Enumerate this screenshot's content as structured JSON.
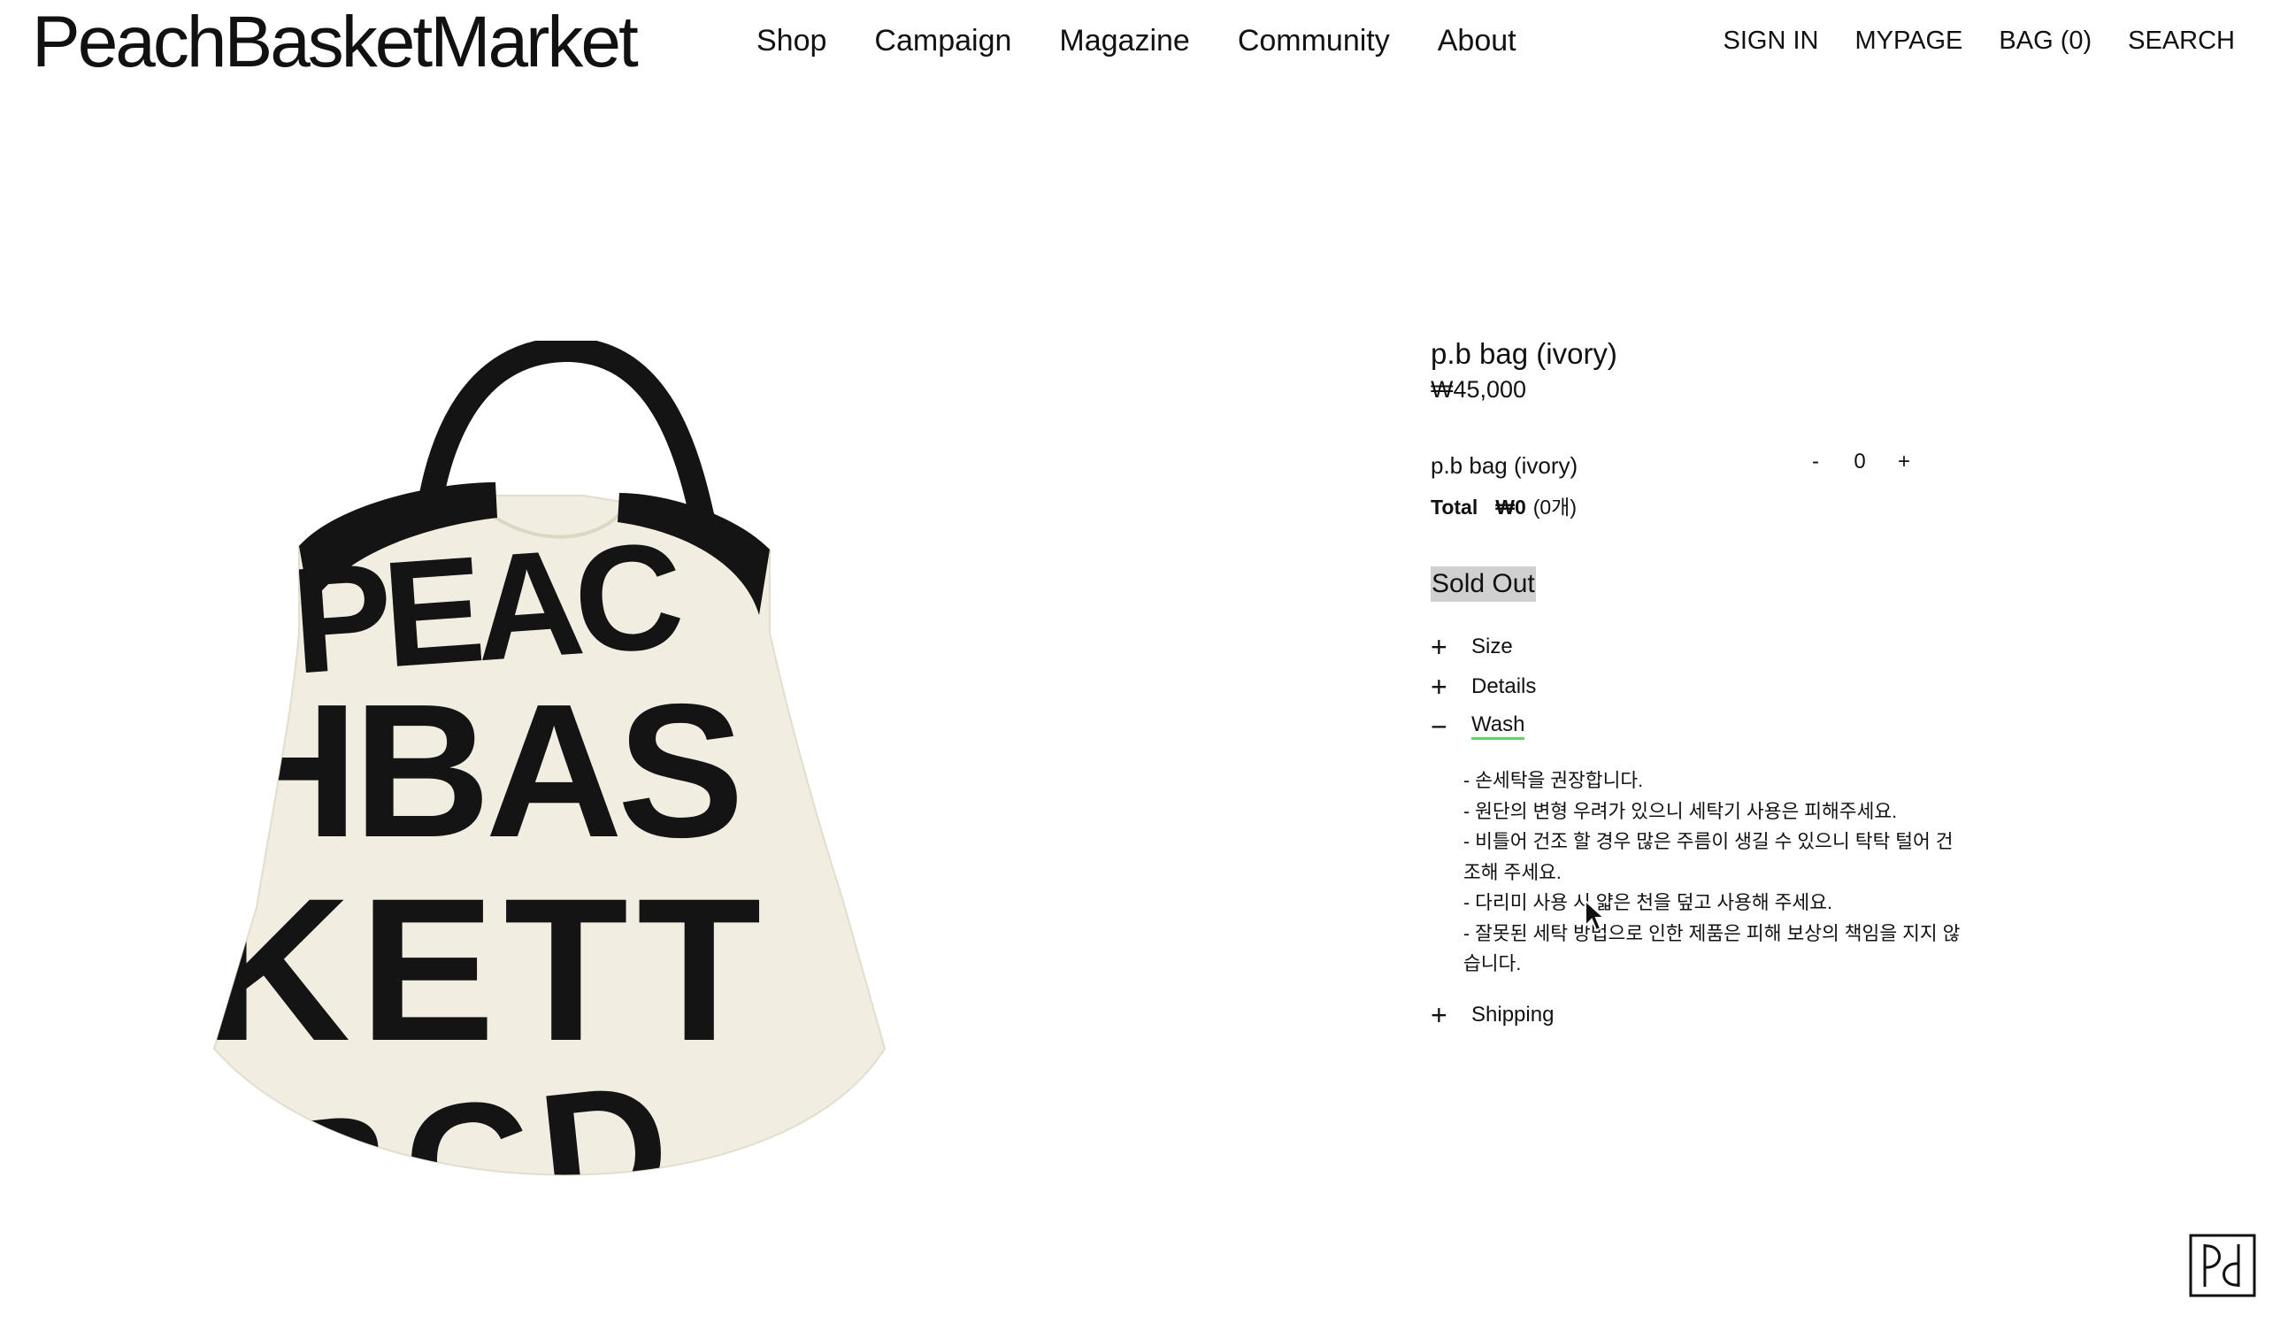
{
  "header": {
    "logo": "PeachBasketMarket",
    "nav": [
      "Shop",
      "Campaign",
      "Magazine",
      "Community",
      "About"
    ],
    "util": [
      "SIGN IN",
      "MYPAGE",
      "BAG (0)",
      "SEARCH"
    ]
  },
  "product": {
    "image_text_lines": [
      "PEAC",
      "HBAS",
      "KETT",
      "BCD"
    ],
    "title": "p.b bag (ivory)",
    "price": "₩45,000",
    "option": {
      "name": "p.b bag (ivory)",
      "minus": "-",
      "quantity": "0",
      "plus": "+"
    },
    "total": {
      "label": "Total",
      "amount": "₩0",
      "count": "(0개)"
    },
    "sold_out": "Sold Out",
    "accordion": {
      "size": {
        "symbol": "+",
        "label": "Size"
      },
      "details": {
        "symbol": "+",
        "label": "Details"
      },
      "wash": {
        "symbol": "−",
        "label": "Wash"
      },
      "shipping": {
        "symbol": "+",
        "label": "Shipping"
      }
    },
    "wash_lines": [
      "- 손세탁을 권장합니다.",
      "- 원단의 변형 우려가 있으니 세탁기 사용은 피해주세요.",
      "- 비틀어 건조 할 경우 많은 주름이 생길 수 있으니 탁탁 털어 건조해 주세요.",
      "- 다리미 사용 시 얇은 천을 덮고 사용해 주세요.",
      "- 잘못된 세탁 방법으로 인한 제품은 피해 보상의 책임을 지지 않습니다."
    ]
  },
  "colors": {
    "text": "#111111",
    "sold_out_bg": "#d0d0d0",
    "active_underline": "#5fd36a",
    "bag_canvas": "#f1ede1"
  }
}
